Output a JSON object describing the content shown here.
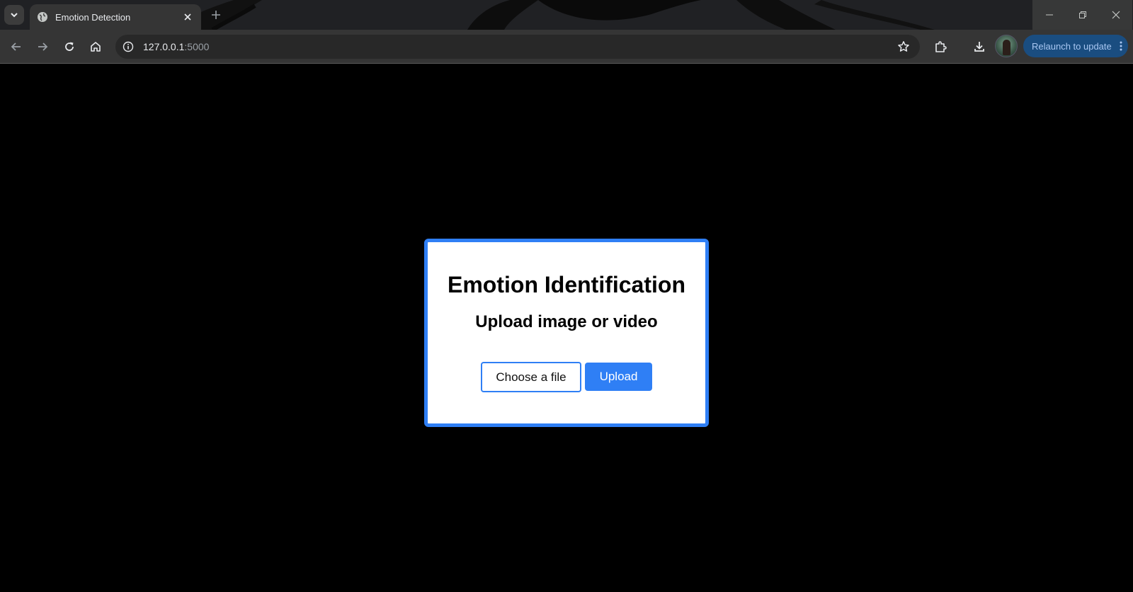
{
  "browser": {
    "tab_title": "Emotion Detection",
    "url_host": "127.0.0.1",
    "url_port": ":5000",
    "relaunch_label": "Relaunch to update",
    "accent_color": "#1a4d80"
  },
  "page": {
    "title": "Emotion Identification",
    "subtitle": "Upload image or video",
    "choose_label": "Choose a file",
    "upload_label": "Upload",
    "accent_color": "#2f7ff5"
  },
  "icons": [
    "tab-search-icon",
    "globe-icon",
    "close-icon",
    "plus-icon",
    "minimize-icon",
    "restore-icon",
    "back-icon",
    "forward-icon",
    "reload-icon",
    "home-icon",
    "info-icon",
    "star-icon",
    "extensions-icon",
    "download-icon",
    "more-vert-icon"
  ]
}
